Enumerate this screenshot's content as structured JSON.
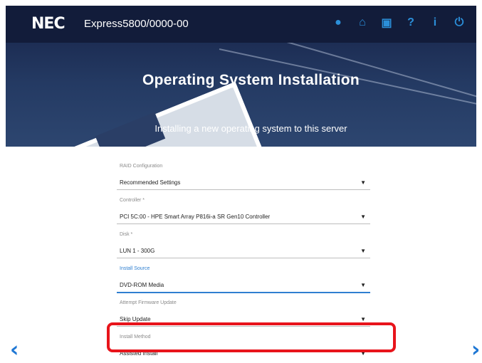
{
  "header": {
    "brand": "NEC",
    "product": "Express5800/0000-00",
    "title": "Operating System Installation",
    "subtitle": "Installing a new operating system to this server",
    "icons": [
      "globe-icon",
      "home-icon",
      "cart-icon",
      "help-icon",
      "info-icon",
      "power-icon"
    ],
    "icon_glyphs": {
      "globe": "●",
      "home": "⌂",
      "cart": "▣",
      "help": "?",
      "info": "i",
      "power": "⏻"
    }
  },
  "form": {
    "fields": [
      {
        "label": "RAID Configuration",
        "value": "Recommended Settings"
      },
      {
        "label": "Controller *",
        "value": "PCI 5C:00 - HPE Smart Array P816i-a SR Gen10 Controller"
      },
      {
        "label": "Disk *",
        "value": "LUN 1 - 300G"
      },
      {
        "label": "Install Source",
        "value": "DVD-ROM Media"
      },
      {
        "label": "Attempt Firmware Update",
        "value": "Skip Update"
      },
      {
        "label": "Install Method",
        "value": "Assisted Install"
      }
    ]
  },
  "nav": {
    "prev": "‹",
    "next": "›"
  },
  "colors": {
    "accent": "#2f7fd0",
    "header_bg": "#121c3a",
    "highlight": "#e8141b"
  }
}
